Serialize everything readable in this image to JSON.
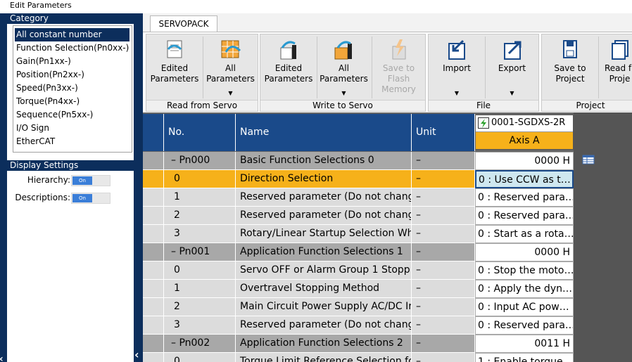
{
  "window": {
    "title": "Edit Parameters"
  },
  "category": {
    "header": "Category",
    "items": [
      "All constant number",
      "Function Selection(Pn0xx-)",
      "Gain(Pn1xx-)",
      "Position(Pn2xx-)",
      "Speed(Pn3xx-)",
      "Torque(Pn4xx-)",
      "Sequence(Pn5xx-)",
      "I/O Sign",
      "EtherCAT"
    ],
    "selected_index": 0
  },
  "display_settings": {
    "header": "Display Settings",
    "hierarchy_label": "Hierarchy:",
    "descriptions_label": "Descriptions:",
    "toggle_on": "On"
  },
  "tab": {
    "label": "SERVOPACK"
  },
  "ribbon": {
    "read": {
      "label": "Read from Servo",
      "edited": "Edited Parameters",
      "all": "All Parameters"
    },
    "write": {
      "label": "Write to Servo",
      "edited": "Edited Parameters",
      "all": "All Parameters",
      "flash": "Save to Flash Memory"
    },
    "file": {
      "label": "File",
      "import": "Import",
      "export": "Export"
    },
    "project": {
      "label": "Project",
      "save": "Save to Project",
      "read": "Read fr Proje"
    }
  },
  "table": {
    "headers": {
      "no": "No.",
      "name": "Name",
      "unit": "Unit"
    },
    "axis": {
      "device": "0001-SGDXS-2R",
      "axis": "Axis A"
    },
    "rows": [
      {
        "type": "group",
        "no": "– Pn000",
        "name": "Basic Function Selections 0",
        "unit": "–",
        "value": "0000 H"
      },
      {
        "type": "sel",
        "no": "0",
        "name": "Direction Selection",
        "unit": "–",
        "value": "0 : Use CCW as t…"
      },
      {
        "type": "normal",
        "no": "1",
        "name": "Reserved parameter (Do not chang",
        "unit": "–",
        "value": "0 : Reserved para…"
      },
      {
        "type": "normal",
        "no": "2",
        "name": "Reserved parameter (Do not chang",
        "unit": "–",
        "value": "0 : Reserved para…"
      },
      {
        "type": "normal",
        "no": "3",
        "name": "Rotary/Linear Startup Selection Wh",
        "unit": "–",
        "value": "0 : Start as a rota…"
      },
      {
        "type": "group",
        "no": "– Pn001",
        "name": "Application Function Selections 1",
        "unit": "–",
        "value": "0000 H"
      },
      {
        "type": "normal",
        "no": "0",
        "name": "Servo OFF or Alarm Group 1 Stoppi",
        "unit": "–",
        "value": "0 : Stop the moto…"
      },
      {
        "type": "normal",
        "no": "1",
        "name": "Overtravel Stopping Method",
        "unit": "–",
        "value": "0 : Apply the dyn…"
      },
      {
        "type": "normal",
        "no": "2",
        "name": "Main Circuit Power Supply AC/DC Ir",
        "unit": "–",
        "value": "0 : Input AC pow…"
      },
      {
        "type": "normal",
        "no": "3",
        "name": "Reserved parameter (Do not chang",
        "unit": "–",
        "value": "0 : Reserved para…"
      },
      {
        "type": "group",
        "no": "– Pn002",
        "name": "Application Function Selections 2",
        "unit": "–",
        "value": "0011 H"
      },
      {
        "type": "normal",
        "no": "0",
        "name": "Torque Limit Reference Selection fo",
        "unit": "–",
        "value": "1 : Enable torque…"
      }
    ]
  }
}
